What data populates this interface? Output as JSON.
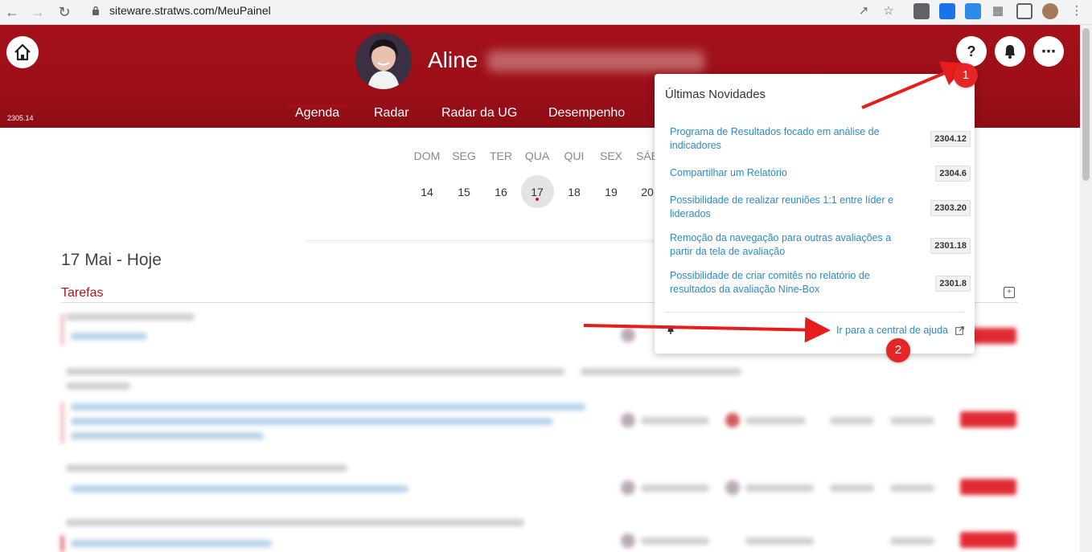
{
  "browser": {
    "url": "siteware.stratws.com/MeuPainel"
  },
  "header": {
    "version": "2305.14",
    "user_first_name": "Aline",
    "nav_tabs": [
      "Agenda",
      "Radar",
      "Radar da UG",
      "Desempenho"
    ]
  },
  "calendar": {
    "weekdays": [
      "DOM",
      "SEG",
      "TER",
      "QUA",
      "QUI",
      "SEX",
      "SÁB"
    ],
    "days": [
      "14",
      "15",
      "16",
      "17",
      "18",
      "19",
      "20"
    ],
    "today": "17"
  },
  "main": {
    "date_title": "17 Mai - Hoje",
    "section_title": "Tarefas"
  },
  "dropdown": {
    "title": "Últimas Novidades",
    "items": [
      {
        "text": "Programa de Resultados focado em análise de indicadores",
        "version": "2304.12"
      },
      {
        "text": "Compartilhar um Relatório",
        "version": "2304.6"
      },
      {
        "text": "Possibilidade de realizar reuniões 1:1 entre líder e liderados",
        "version": "2303.20"
      },
      {
        "text": "Remoção da navegação para outras avaliações a partir da tela de avaliação",
        "version": "2301.18"
      },
      {
        "text": "Possibilidade de criar comitês no relatório de resultados da avaliação Nine-Box",
        "version": "2301.8"
      }
    ],
    "help_link": "Ir para a central de ajuda"
  },
  "annotations": {
    "step1": "1",
    "step2": "2"
  },
  "colors": {
    "brand_red": "#a4101a",
    "link_blue": "#2d8ac7",
    "annotation_red": "#e52626"
  }
}
